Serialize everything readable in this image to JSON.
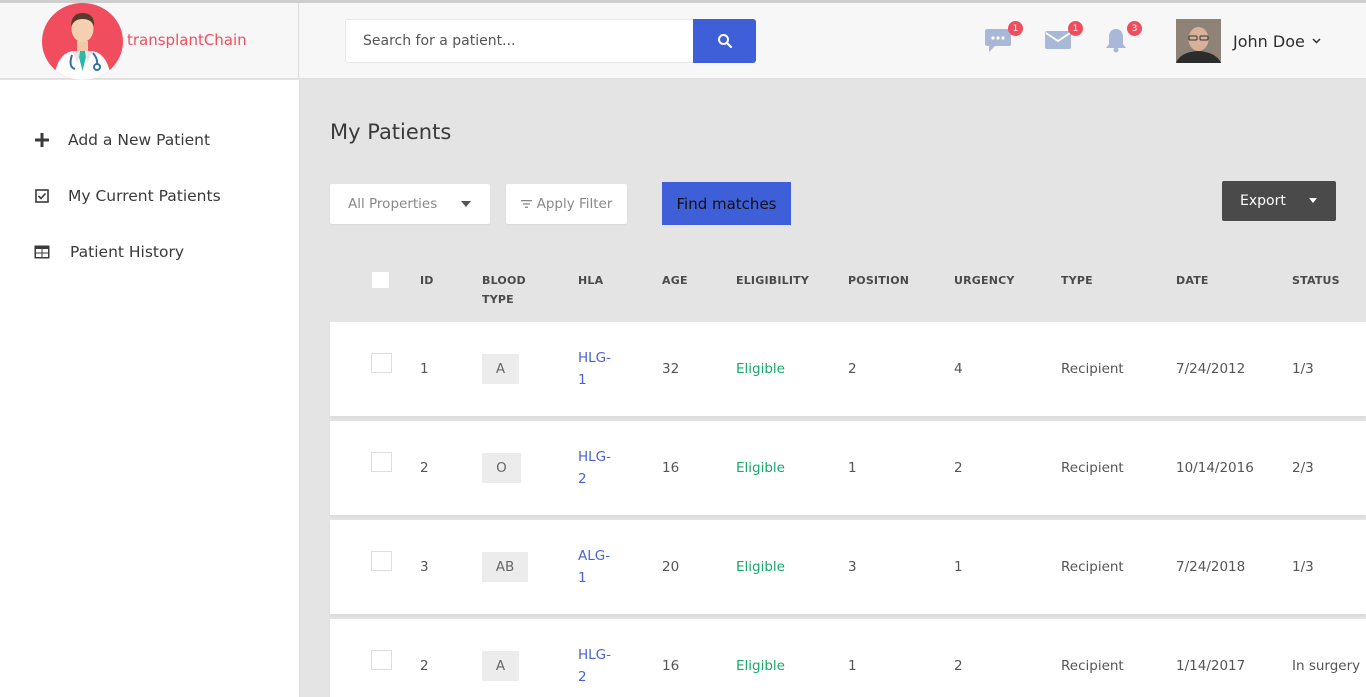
{
  "app": {
    "brand": "transplantChain"
  },
  "search": {
    "placeholder": "Search for a patient..."
  },
  "notifications": {
    "messages_count": "1",
    "mail_count": "1",
    "alerts_count": "3"
  },
  "user": {
    "name": "John Doe"
  },
  "sidebar": {
    "items": [
      {
        "label": "Add a New Patient",
        "icon": "plus-icon"
      },
      {
        "label": "My Current Patients",
        "icon": "checkbox-icon"
      },
      {
        "label": "Patient History",
        "icon": "table-icon"
      }
    ]
  },
  "main": {
    "title": "My Patients",
    "properties_select": "All Properties",
    "filter_label": "Apply Filter",
    "find_label": "Find matches",
    "export_label": "Export"
  },
  "table": {
    "headers": {
      "id": "ID",
      "blood_1": "BLOOD",
      "blood_2": "TYPE",
      "hla": "HLA",
      "age": "AGE",
      "eligibility": "ELIGIBILITY",
      "position": "POSITION",
      "urgency": "URGENCY",
      "type": "TYPE",
      "date": "DATE",
      "status": "STATUS"
    },
    "rows": [
      {
        "id": "1",
        "blood": "A",
        "hla_1": "HLG-",
        "hla_2": "1",
        "age": "32",
        "eligibility": "Eligible",
        "position": "2",
        "urgency": "4",
        "type": "Recipient",
        "date": "7/24/2012",
        "status": "1/3"
      },
      {
        "id": "2",
        "blood": "O",
        "hla_1": "HLG-",
        "hla_2": "2",
        "age": "16",
        "eligibility": "Eligible",
        "position": "1",
        "urgency": "2",
        "type": "Recipient",
        "date": "10/14/2016",
        "status": "2/3"
      },
      {
        "id": "3",
        "blood": "AB",
        "hla_1": "ALG-",
        "hla_2": "1",
        "age": "20",
        "eligibility": "Eligible",
        "position": "3",
        "urgency": "1",
        "type": "Recipient",
        "date": "7/24/2018",
        "status": "1/3"
      },
      {
        "id": "2",
        "blood": "A",
        "hla_1": "HLG-",
        "hla_2": "2",
        "age": "16",
        "eligibility": "Eligible",
        "position": "1",
        "urgency": "2",
        "type": "Recipient",
        "date": "1/14/2017",
        "status": "In surgery"
      }
    ]
  },
  "colors": {
    "brand": "#f04e5e",
    "primary": "#3f5fd8",
    "eligible": "#18a868",
    "link": "#4a62d8"
  }
}
